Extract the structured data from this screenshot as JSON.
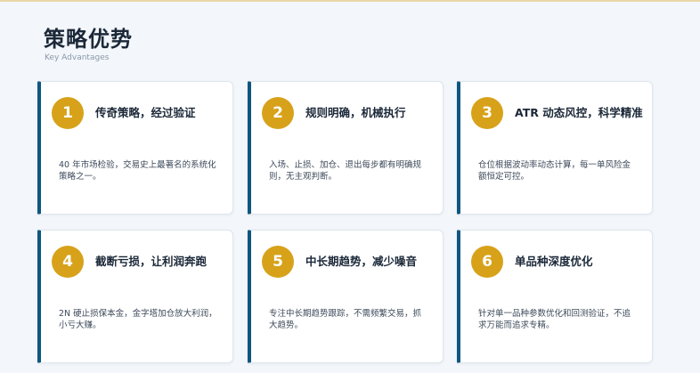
{
  "header": {
    "title": "策略优势",
    "subtitle": "Key Advantages"
  },
  "cards": [
    {
      "number": "1",
      "title": "传奇策略，经过验证",
      "desc": "40 年市场检验，交易史上最著名的系统化策略之一。"
    },
    {
      "number": "2",
      "title": "规则明确，机械执行",
      "desc": "入场、止损、加仓、退出每步都有明确规则，无主观判断。"
    },
    {
      "number": "3",
      "title": "ATR 动态风控，科学精准",
      "desc": "仓位根据波动率动态计算，每一单风险金额恒定可控。"
    },
    {
      "number": "4",
      "title": "截断亏损，让利润奔跑",
      "desc": "2N 硬止损保本金，金字塔加仓放大利润，小亏大赚。"
    },
    {
      "number": "5",
      "title": "中长期趋势，减少噪音",
      "desc": "专注中长期趋势跟踪，不需频繁交易，抓大趋势。"
    },
    {
      "number": "6",
      "title": "单品种深度优化",
      "desc": "针对单一品种参数优化和回测验证，不追求万能而追求专精。"
    }
  ],
  "colors": {
    "accent_bar": "#0f5680",
    "badge": "#d7a21a",
    "background": "#f3f6fa"
  }
}
